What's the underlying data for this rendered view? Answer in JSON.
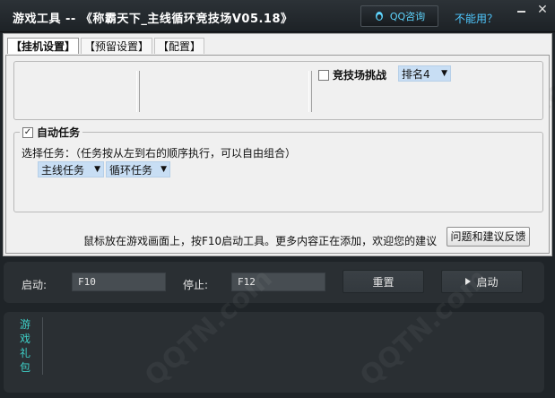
{
  "window": {
    "title": "游戏工具 -- 《称霸天下_主线循环竞技场V05.18》",
    "qq_button": "QQ咨询",
    "help_link": "不能用？",
    "qq_icon": "qq-penguin-icon"
  },
  "tabs": [
    {
      "label": "【挂机设置】",
      "active": true
    },
    {
      "label": "【预留设置】",
      "active": false
    },
    {
      "label": "【配置】",
      "active": false
    }
  ],
  "arena": {
    "checkbox_label": "竞技场挑战",
    "checked": false,
    "rank_value": "排名4"
  },
  "auto_task": {
    "checkbox_label": "自动任务",
    "checked": true,
    "select_label": "选择任务：（任务按从左到右的顺序执行，可以自由组合）",
    "task1": "主线任务",
    "task2": "循环任务"
  },
  "footer_text": "鼠标放在游戏画面上，按F10启动工具。更多内容正在添加，欢迎您的建议",
  "feedback_button": "问题和建议反馈",
  "hotkeys": {
    "start_label": "启动:",
    "start_value": "F10",
    "stop_label": "停止:",
    "stop_value": "F12",
    "reset_button": "重置",
    "start_button": "启动"
  },
  "gift_tab": "游戏礼包",
  "colors": {
    "accent_cyan": "#5fd6ff",
    "gift_teal": "#3ed0c8",
    "dropdown_bg": "#c8def4"
  }
}
